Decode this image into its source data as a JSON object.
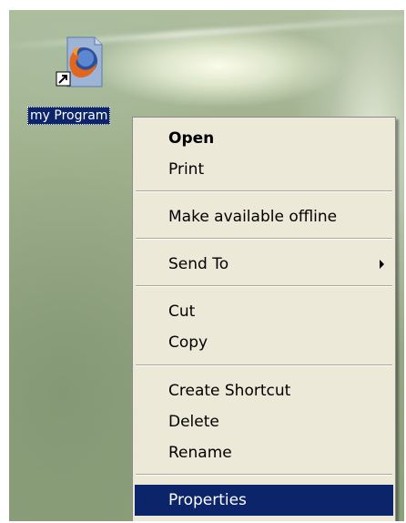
{
  "desktop": {
    "icon": {
      "label": "my Program",
      "icon_name": "firefox-shortcut-icon",
      "shortcut_overlay": "shortcut-arrow-icon"
    }
  },
  "context_menu": {
    "items": [
      {
        "label": "Open"
      },
      {
        "label": "Print"
      },
      {
        "label": "Make available offline"
      },
      {
        "label": "Send To"
      },
      {
        "label": "Cut"
      },
      {
        "label": "Copy"
      },
      {
        "label": "Create Shortcut"
      },
      {
        "label": "Delete"
      },
      {
        "label": "Rename"
      },
      {
        "label": "Properties"
      }
    ],
    "submenu_icon": "chevron-right-icon"
  },
  "colors": {
    "selection": "#0b246a",
    "menu_background": "#ece9d8"
  }
}
